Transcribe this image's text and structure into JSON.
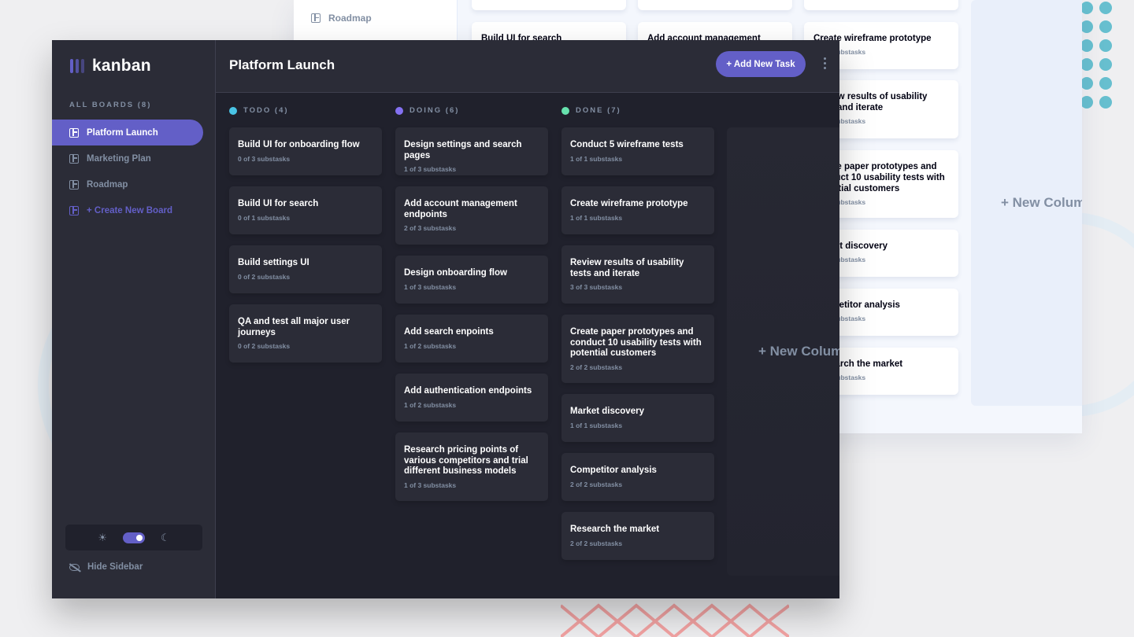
{
  "colors": {
    "accent": "#635fc7",
    "todo": "#49c4e5",
    "doing": "#8471f2",
    "done": "#67e2ae"
  },
  "background_window": {
    "sidebar_item": "Roadmap",
    "col1": [
      {
        "title": "Build UI for search",
        "sub": ""
      }
    ],
    "col2": [
      {
        "title": "Add account management",
        "sub": ""
      }
    ],
    "col3": [
      {
        "title": "Create wireframe prototype",
        "sub": "1 of 1 substasks"
      },
      {
        "title": "Review results of usability tests and iterate",
        "sub": "3 of 3 substasks"
      },
      {
        "title": "Create paper prototypes and conduct 10 usability tests with potential customers",
        "sub": "2 of 2 substasks"
      },
      {
        "title": "Market discovery",
        "sub": "1 of 1 substasks"
      },
      {
        "title": "Competitor analysis",
        "sub": "2 of 2 substasks"
      },
      {
        "title": "Research the market",
        "sub": "2 of 2 substasks"
      }
    ],
    "new_column": "+ New Column"
  },
  "app": {
    "logo": "kanban"
  },
  "sidebar": {
    "heading": "ALL BOARDS (8)",
    "boards": [
      {
        "label": "Platform Launch",
        "active": true
      },
      {
        "label": "Marketing Plan",
        "active": false
      },
      {
        "label": "Roadmap",
        "active": false
      }
    ],
    "create_board": "+ Create New Board",
    "hide_sidebar": "Hide Sidebar",
    "theme": "dark"
  },
  "header": {
    "title": "Platform Launch",
    "add_task": "+ Add New Task"
  },
  "columns": [
    {
      "name": "TODO (4)",
      "cards": [
        {
          "title": "Build UI for onboarding flow",
          "sub": "0 of 3 substasks"
        },
        {
          "title": "Build UI for search",
          "sub": "0 of 1 substasks"
        },
        {
          "title": "Build settings UI",
          "sub": "0 of 2 substasks"
        },
        {
          "title": "QA and test all major user journeys",
          "sub": "0 of 2 substasks"
        }
      ]
    },
    {
      "name": "DOING (6)",
      "cards": [
        {
          "title": "Design settings and search pages",
          "sub": "1 of 3 substasks"
        },
        {
          "title": "Add account management endpoints",
          "sub": "2 of 3 substasks"
        },
        {
          "title": "Design onboarding flow",
          "sub": "1 of 3 substasks"
        },
        {
          "title": "Add search enpoints",
          "sub": "1 of 2 substasks"
        },
        {
          "title": "Add authentication endpoints",
          "sub": "1 of 2 substasks"
        },
        {
          "title": "Research pricing points of various competitors and trial different business models",
          "sub": "1 of 3 substasks"
        }
      ]
    },
    {
      "name": "DONE (7)",
      "cards": [
        {
          "title": "Conduct 5 wireframe tests",
          "sub": "1 of 1 substasks"
        },
        {
          "title": "Create wireframe prototype",
          "sub": "1 of 1 substasks"
        },
        {
          "title": "Review results of usability tests and iterate",
          "sub": "3 of 3 substasks"
        },
        {
          "title": "Create paper prototypes and conduct 10 usability tests with potential customers",
          "sub": "2 of 2 substasks"
        },
        {
          "title": "Market discovery",
          "sub": "1 of 1 substasks"
        },
        {
          "title": "Competitor analysis",
          "sub": "2 of 2 substasks"
        },
        {
          "title": "Research the market",
          "sub": "2 of 2 substasks"
        }
      ]
    }
  ],
  "new_column": "+ New Column"
}
